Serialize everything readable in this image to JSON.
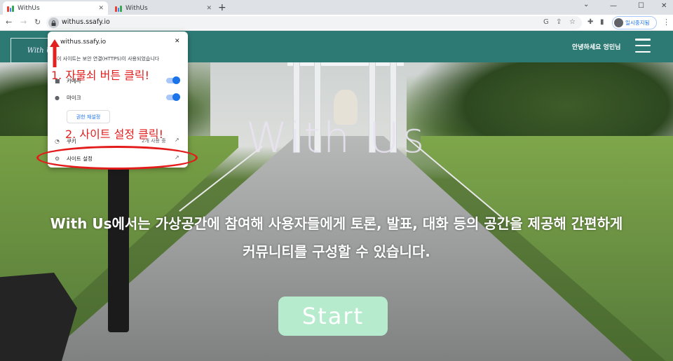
{
  "browser": {
    "tabs": [
      {
        "title": "WithUs",
        "active": true
      },
      {
        "title": "WithUs",
        "active": false
      }
    ],
    "new_tab": "+",
    "window_controls": {
      "minimize": "—",
      "maximize": "☐",
      "close": "✕"
    },
    "url": "withus.ssafy.io",
    "profile_label": "일시중지됨",
    "favicon_colors": [
      "#ea4335",
      "#4285f4",
      "#34a853"
    ]
  },
  "site_info_popup": {
    "host": "withus.ssafy.io",
    "security_text": "이 사이트는 보안 연결(HTTPS)이 사용되었습니다",
    "camera_label": "카메라",
    "camera_on": true,
    "mic_label": "마이크",
    "mic_on": true,
    "reset_permissions_label": "권한 재설정",
    "cookie_label": "쿠키",
    "cookie_value": "2개 사용 중",
    "site_settings_label": "사이트 설정"
  },
  "page": {
    "logo_text": "With Us",
    "greeting": "안녕하세요 엉민님",
    "hero_title": "With Us",
    "hero_description": "With Us에서는 가상공간에 참여해 사용자들에게 토론, 발표, 대화 등의 공간을 제공해 간편하게 커뮤니티를 구성할 수 있습니다.",
    "start_button": "Start",
    "header_color": "#2d7a74",
    "start_color": "#b6eccd"
  },
  "annotations": {
    "step1": "1. 자물쇠 버튼 클릭!",
    "step2": "2. 사이트 설정 클릭!",
    "color": "#e32020"
  }
}
